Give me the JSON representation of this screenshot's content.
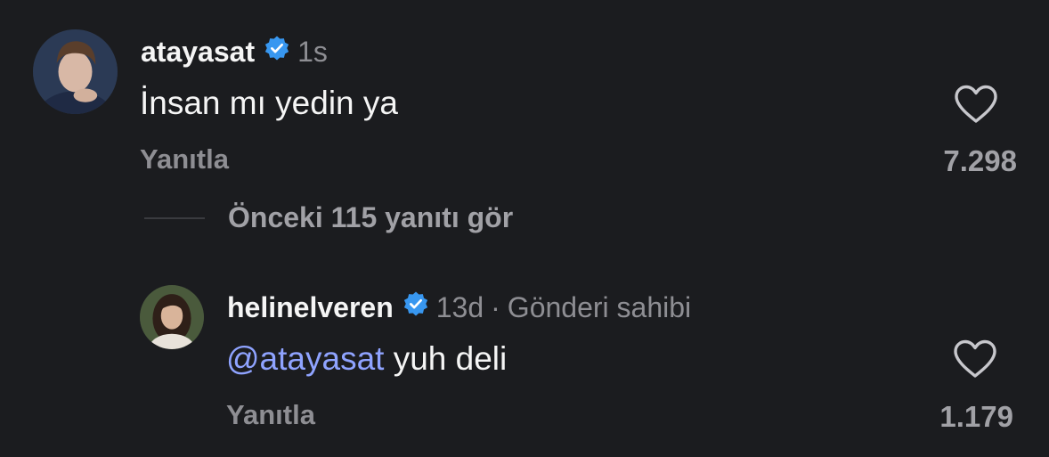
{
  "comments": [
    {
      "username": "atayasat",
      "time": "1s",
      "text": "İnsan mı yedin ya",
      "reply_label": "Yanıtla",
      "like_count": "7.298",
      "verified": true
    }
  ],
  "view_replies_label": "Önceki 115 yanıtı gör",
  "reply": {
    "username": "helinelveren",
    "time": "13d",
    "separator": "·",
    "owner_label": "Gönderi sahibi",
    "mention": "@atayasat",
    "text": " yuh deli",
    "reply_label": "Yanıtla",
    "like_count": "1.179",
    "verified": true
  },
  "colors": {
    "background": "#1b1c1f",
    "verified": "#3897f0",
    "mention": "#8fa3ff",
    "muted": "#8e8e93"
  }
}
